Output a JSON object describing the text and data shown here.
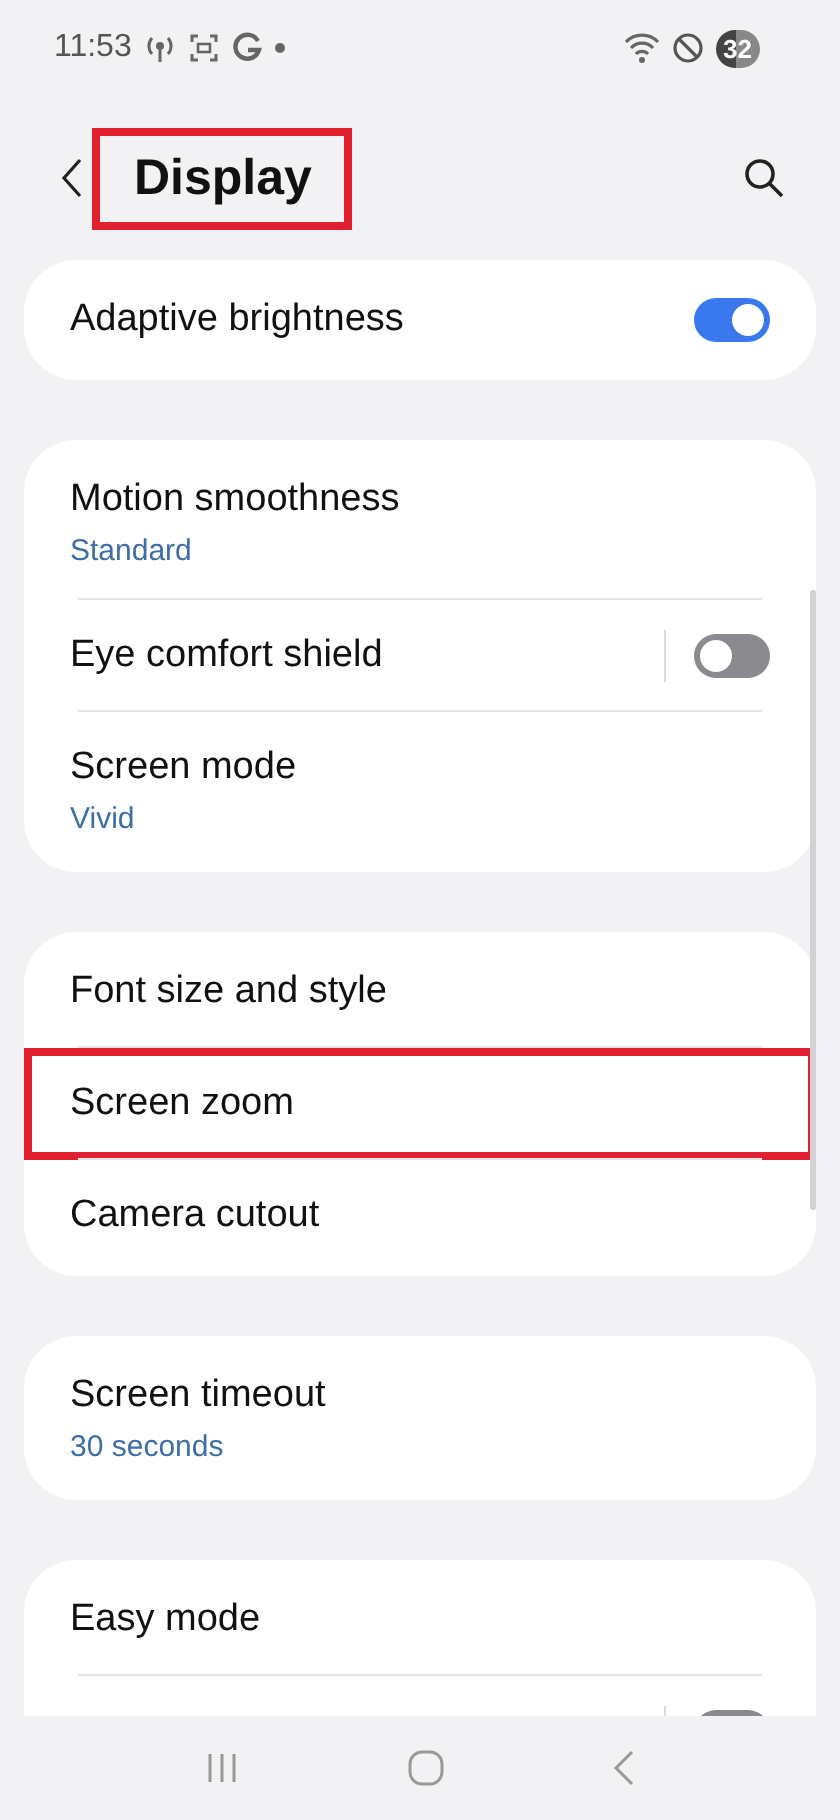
{
  "status_bar": {
    "time": "11:53",
    "battery": "32"
  },
  "header": {
    "title": "Display",
    "highlighted": true
  },
  "groups": [
    {
      "items": [
        {
          "kind": "toggle",
          "label": "Adaptive brightness",
          "on": true,
          "highlighted": false
        }
      ]
    },
    {
      "items": [
        {
          "kind": "link",
          "label": "Motion smoothness",
          "sub": "Standard",
          "highlighted": false
        },
        {
          "kind": "split-toggle",
          "label": "Eye comfort shield",
          "on": false,
          "highlighted": false
        },
        {
          "kind": "link",
          "label": "Screen mode",
          "sub": "Vivid",
          "highlighted": false
        }
      ]
    },
    {
      "items": [
        {
          "kind": "link",
          "label": "Font size and style",
          "highlighted": false
        },
        {
          "kind": "link",
          "label": "Screen zoom",
          "highlighted": true
        },
        {
          "kind": "link",
          "label": "Camera cutout",
          "highlighted": false
        }
      ]
    },
    {
      "items": [
        {
          "kind": "link",
          "label": "Screen timeout",
          "sub": "30 seconds",
          "highlighted": false
        }
      ]
    },
    {
      "items": [
        {
          "kind": "link",
          "label": "Easy mode",
          "highlighted": false
        },
        {
          "kind": "split-toggle",
          "on": false,
          "highlighted": false
        }
      ]
    }
  ]
}
